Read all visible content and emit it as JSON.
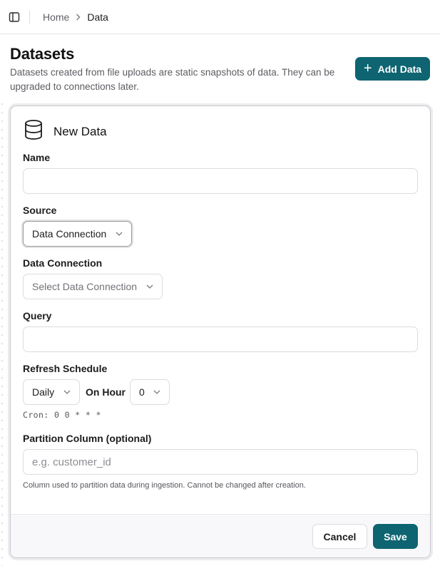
{
  "breadcrumb": {
    "home": "Home",
    "separator": "›",
    "current": "Data"
  },
  "page": {
    "title": "Datasets",
    "description": "Datasets created from file uploads are static snapshots of data. They can be upgraded to connections later.",
    "add_button_label": "Add Data",
    "add_button_icon": "plus-icon"
  },
  "form": {
    "title": "New Data",
    "title_icon": "database-icon",
    "name": {
      "label": "Name",
      "value": "",
      "placeholder": ""
    },
    "source": {
      "label": "Source",
      "selected": "Data Connection"
    },
    "data_connection": {
      "label": "Data Connection",
      "placeholder": "Select Data Connection"
    },
    "query": {
      "label": "Query",
      "value": "",
      "placeholder": ""
    },
    "refresh_schedule": {
      "label": "Refresh Schedule",
      "frequency": "Daily",
      "on_hour_label": "On Hour",
      "hour": "0",
      "cron": "Cron: 0 0 * * *"
    },
    "partition_column": {
      "label": "Partition Column (optional)",
      "placeholder": "e.g. customer_id",
      "helper": "Column used to partition data during ingestion. Cannot be changed after creation."
    },
    "cancel_label": "Cancel",
    "save_label": "Save"
  },
  "colors": {
    "primary": "#0e6471",
    "border": "#dcdce1",
    "muted_text": "#5c5d63"
  }
}
